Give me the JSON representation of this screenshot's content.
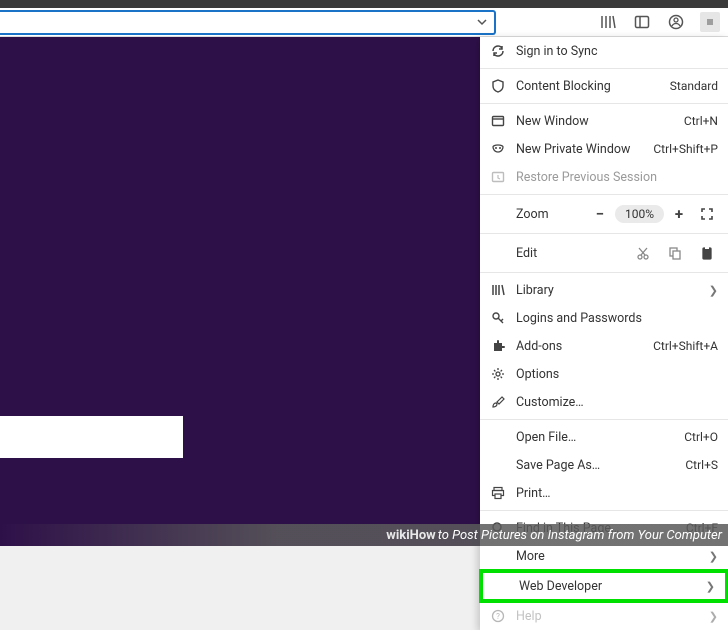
{
  "menu": {
    "sign_in": "Sign in to Sync",
    "content_blocking": "Content Blocking",
    "content_blocking_status": "Standard",
    "new_window": "New Window",
    "new_window_sc": "Ctrl+N",
    "new_private": "New Private Window",
    "new_private_sc": "Ctrl+Shift+P",
    "restore_session": "Restore Previous Session",
    "zoom_label": "Zoom",
    "zoom_pct": "100%",
    "edit_label": "Edit",
    "library": "Library",
    "logins": "Logins and Passwords",
    "addons": "Add-ons",
    "addons_sc": "Ctrl+Shift+A",
    "options": "Options",
    "customize": "Customize…",
    "open_file": "Open File…",
    "open_file_sc": "Ctrl+O",
    "save_page": "Save Page As…",
    "save_page_sc": "Ctrl+S",
    "print": "Print…",
    "find": "Find in This Page…",
    "find_sc": "Ctrl+F",
    "more": "More",
    "web_developer": "Web Developer",
    "help": "Help"
  },
  "caption": {
    "brand": "wikiHow",
    "text": " to Post Pictures on Instagram from Your Computer"
  }
}
